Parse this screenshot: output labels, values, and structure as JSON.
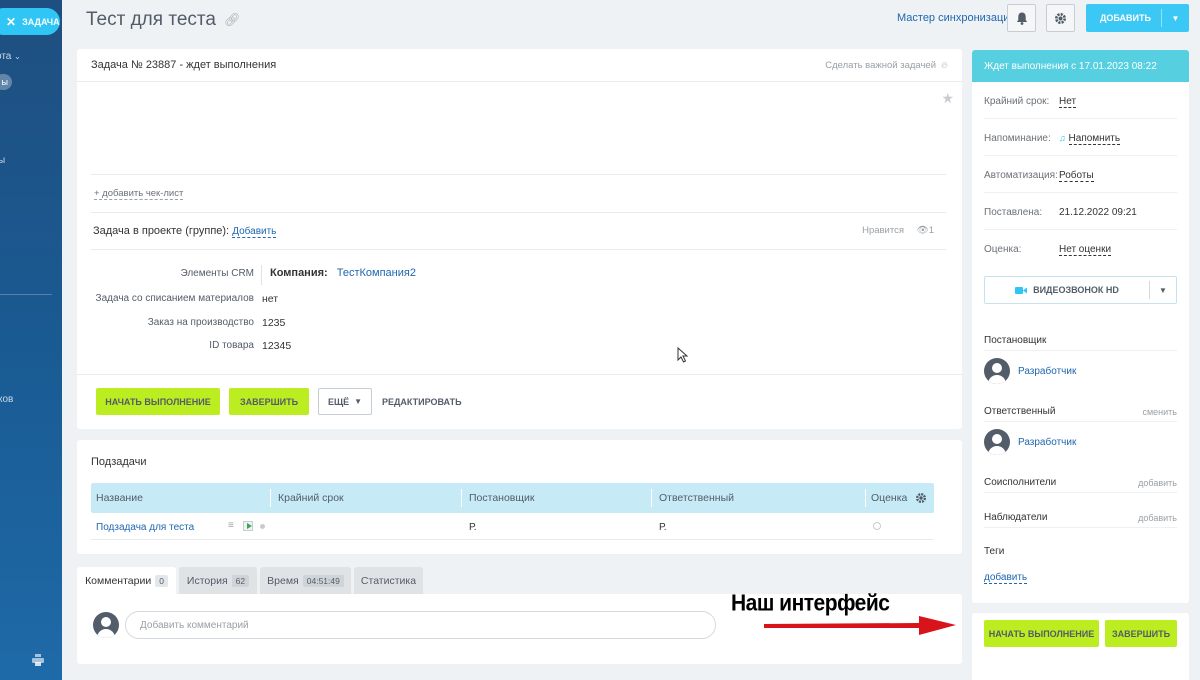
{
  "sidebar": {
    "task_label": "ЗАДАЧА",
    "frag_1": "ота",
    "frag_2": "ы",
    "frag_3": "ы",
    "frag_4": "ков"
  },
  "header": {
    "title": "Тест для теста",
    "sync_link": "Мастер синхронизации",
    "add_button": "ДОБАВИТЬ"
  },
  "task": {
    "title": "Задача № 23887 - ждет выполнения",
    "important_link": "Сделать важной задачей",
    "checklist_link": "+ добавить чек-лист",
    "project_label": "Задача в проекте (группе):",
    "project_add": "Добавить",
    "likes_label": "Нравится",
    "views_count": "1",
    "fields": [
      {
        "label": "Элементы CRM",
        "value": ""
      },
      {
        "label": "Задача со списанием материалов",
        "value": "нет"
      },
      {
        "label": "Заказ на производство",
        "value": "1235"
      },
      {
        "label": "ID товара",
        "value": "12345"
      }
    ],
    "crm_type": "Компания:",
    "crm_company": "ТестКомпания2",
    "buttons": {
      "start": "НАЧАТЬ ВЫПОЛНЕНИЕ",
      "finish": "ЗАВЕРШИТЬ",
      "more": "ЕЩЁ",
      "edit": "РЕДАКТИРОВАТЬ"
    }
  },
  "subtasks": {
    "title": "Подзадачи",
    "columns": [
      "Название",
      "Крайний срок",
      "Постановщик",
      "Ответственный",
      "Оценка"
    ],
    "rows": [
      {
        "name": "Подзадача для теста",
        "deadline": "",
        "creator": "Р.",
        "responsible": "Р."
      }
    ]
  },
  "tabs": [
    {
      "label": "Комментарии",
      "count": "0",
      "active": true
    },
    {
      "label": "История",
      "count": "62",
      "active": false
    },
    {
      "label": "Время",
      "count": "04:51:49",
      "active": false
    },
    {
      "label": "Статистика",
      "count": "",
      "active": false
    }
  ],
  "comments": {
    "placeholder": "Добавить комментарий"
  },
  "annotation": {
    "text": "Наш интерфейс",
    "arrow_color": "#d8141a"
  },
  "side": {
    "status": "Ждет выполнения с 17.01.2023 08:22",
    "props": [
      {
        "key": "Крайний срок:",
        "value": "Нет"
      },
      {
        "key": "Напоминание:",
        "value": "Напомнить"
      },
      {
        "key": "Автоматизация:",
        "value": "Роботы"
      },
      {
        "key": "Поставлена:",
        "value": "21.12.2022 09:21"
      },
      {
        "key": "Оценка:",
        "value": "Нет оценки"
      }
    ],
    "video_button": "ВИДЕОЗВОНОК HD",
    "creator_label": "Постановщик",
    "creator_name": "Разработчик",
    "responsible_label": "Ответственный",
    "responsible_change": "сменить",
    "responsible_name": "Разработчик",
    "coexecutors_label": "Соисполнители",
    "coexecutors_add": "добавить",
    "observers_label": "Наблюдатели",
    "observers_add": "добавить",
    "tags_label": "Теги",
    "tags_add": "добавить",
    "bottom_start": "НАЧАТЬ ВЫПОЛНЕНИЕ",
    "bottom_finish": "ЗАВЕРШИТЬ"
  },
  "colors": {
    "accent": "#3bc8f5",
    "status_bar": "#56d0e0",
    "green_button": "#bbed21",
    "link": "#2067b0",
    "table_head": "#c6ebf7"
  },
  "icons": [
    "close-icon",
    "link-icon",
    "bell-icon",
    "gear-icon",
    "flame-icon",
    "star-icon",
    "eye-icon",
    "chevron-down-icon",
    "play-icon",
    "menu-icon",
    "video-camera-icon",
    "bell-small-icon",
    "printer-icon",
    "avatar-icon",
    "cursor-icon"
  ]
}
